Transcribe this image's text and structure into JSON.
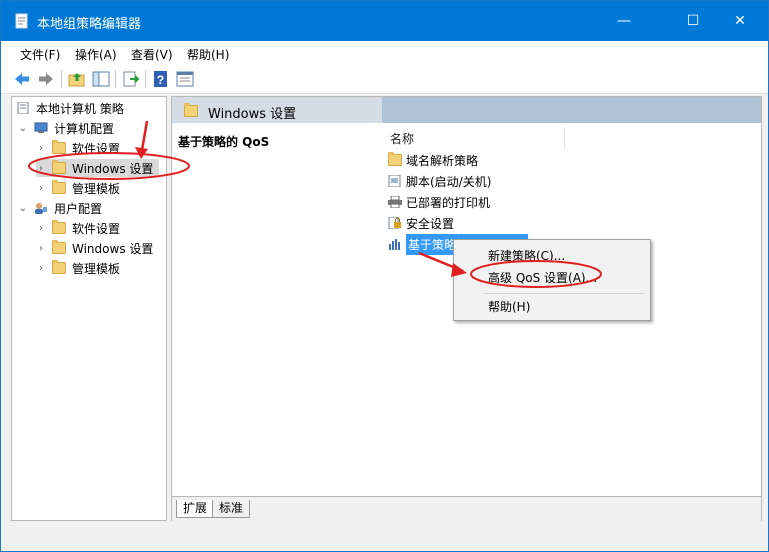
{
  "window": {
    "title": "本地组策略编辑器",
    "minimize_glyph": "—",
    "maximize_glyph": "☐",
    "close_glyph": "✕"
  },
  "menu": [
    "文件(F)",
    "操作(A)",
    "查看(V)",
    "帮助(H)"
  ],
  "toolbar_icons": [
    "back-arrow-icon",
    "forward-arrow-icon",
    "up-folder-icon",
    "show-hide-tree-icon",
    "export-list-icon",
    "help-icon",
    "properties-icon"
  ],
  "tree": {
    "root": "本地计算机 策略",
    "computer_config": "计算机配置",
    "cc_software": "软件设置",
    "cc_windows": "Windows 设置",
    "cc_admin": "管理模板",
    "user_config": "用户配置",
    "uc_software": "软件设置",
    "uc_windows": "Windows 设置",
    "uc_admin": "管理模板"
  },
  "right": {
    "header": "Windows 设置",
    "section_title": "基于策略的 QoS",
    "column_name": "名称",
    "items": [
      {
        "label": "域名解析策略",
        "icon": "folder-icon"
      },
      {
        "label": "脚本(启动/关机)",
        "icon": "script-icon"
      },
      {
        "label": "已部署的打印机",
        "icon": "printer-icon"
      },
      {
        "label": "安全设置",
        "icon": "security-icon"
      },
      {
        "label": "基于策略的 QoS",
        "icon": "qos-chart-icon"
      }
    ],
    "selected_visible_text": "基于策略的",
    "tabs": [
      "扩展",
      "标准"
    ]
  },
  "context_menu": {
    "items": [
      "新建策略(C)...",
      "高级 QoS 设置(A)...",
      "帮助(H)"
    ]
  },
  "colors": {
    "titlebar": "#0078d7",
    "selection": "#3399ff",
    "annotation_red": "#e02020"
  }
}
